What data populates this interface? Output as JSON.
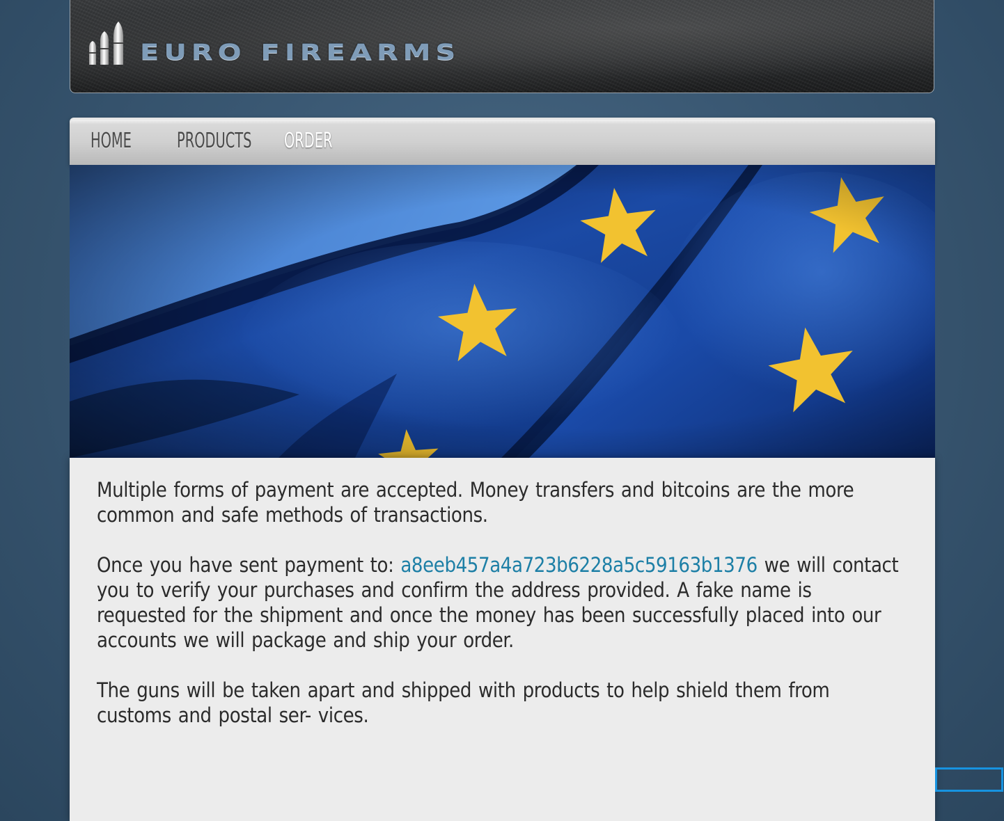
{
  "site": {
    "logo_text": "EURO FIREARMS"
  },
  "nav": {
    "items": [
      {
        "label": "HOME",
        "active": false
      },
      {
        "label": "PRODUCTS",
        "active": false
      },
      {
        "label": "ORDER",
        "active": true
      }
    ]
  },
  "banner": {
    "subject": "European Union flag"
  },
  "content": {
    "paragraph_1": "Multiple forms of payment are accepted. Money transfers and bitcoins are the more common and safe methods of transactions.",
    "paragraph_2_prefix": "Once you have sent payment to: ",
    "wallet_address": "a8eeb457a4a723b6228a5c59163b1376",
    "paragraph_2_suffix": " we will contact you to verify your purchases and confirm the address provided. A fake name is requested for the shipment and once the money has been successfully placed into our accounts we will package and ship your order.",
    "paragraph_3": "The guns will be taken apart and shipped with products to help shield them from customs and postal ser- vices."
  },
  "colors": {
    "background": "#3a5873",
    "link": "#1d7fa6",
    "content_bg": "#ececec",
    "flag_blue": "#1a4aa8",
    "star_yellow": "#f2c230"
  }
}
